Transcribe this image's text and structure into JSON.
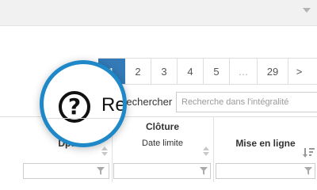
{
  "topbar": {
    "dropdown_icon": "caret-down-icon"
  },
  "pagination": {
    "pages": [
      "1",
      "2",
      "3",
      "4",
      "5",
      "…",
      "29",
      ">"
    ],
    "active_page": "1"
  },
  "help": {
    "icon": "question-circle-icon",
    "magnified_text": "Re"
  },
  "search": {
    "label": "Rechercher",
    "placeholder": "Recherche dans l'intégralité",
    "value": ""
  },
  "table": {
    "columns": [
      {
        "label": "Dpt.",
        "sort": "none"
      },
      {
        "label": "Clôture",
        "sublabel": "Date limite",
        "sort": "none"
      },
      {
        "label": "Mise en ligne",
        "sort": "descending"
      }
    ],
    "filter_icon": "funnel-icon"
  },
  "colors": {
    "accent": "#1e88c8",
    "active_page": "#337ab7"
  }
}
